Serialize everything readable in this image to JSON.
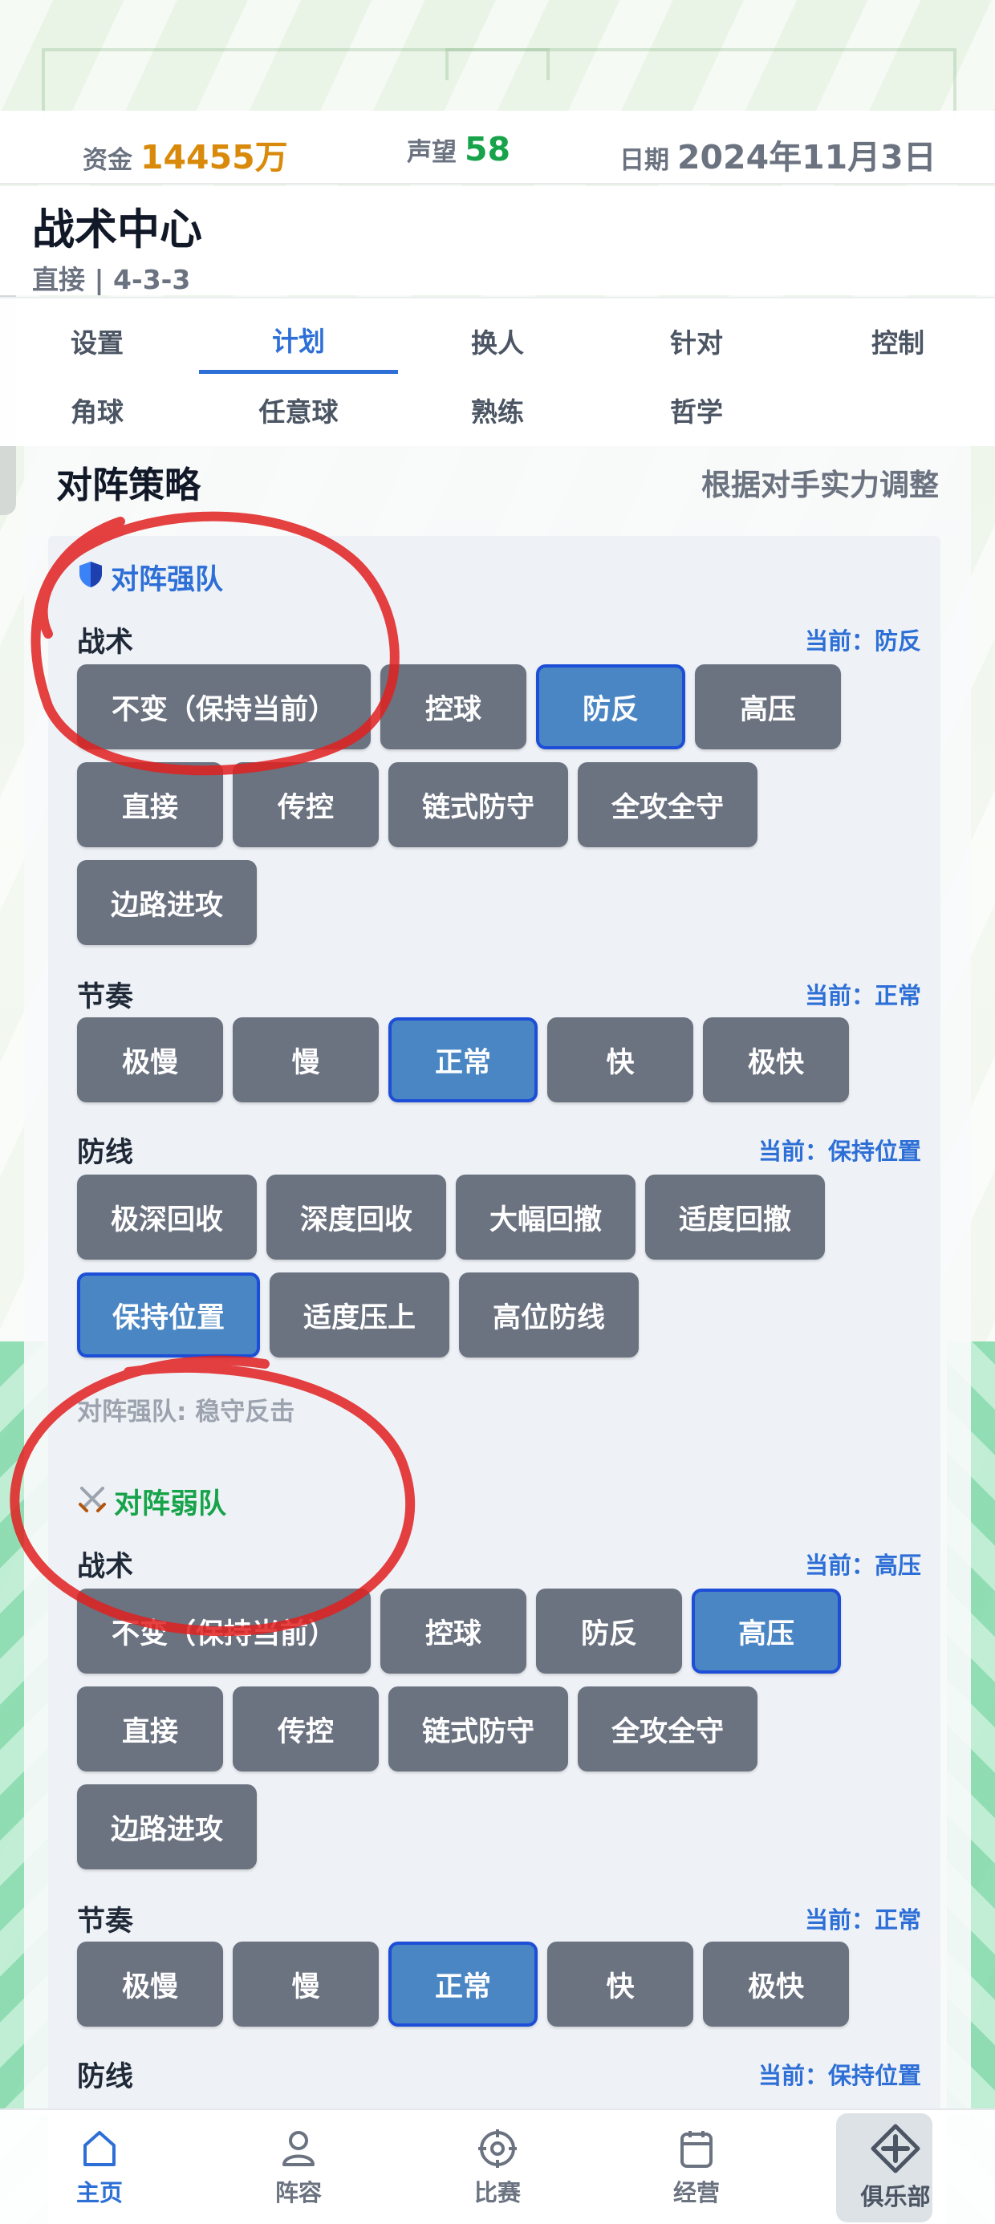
{
  "colors": {
    "accent_blue": "#2d6fd6",
    "button_gray": "#6b7280",
    "button_active": "#4a86c4",
    "funds_orange": "#d98a0b",
    "reputation_green": "#16a34a",
    "annotation_red": "#e02020"
  },
  "stats": {
    "funds_label": "资金",
    "funds_value": "14455万",
    "reputation_label": "声望",
    "reputation_value": "58",
    "date_label": "日期",
    "date_value": "2024年11月3日"
  },
  "header": {
    "title": "战术中心",
    "subtitle": "直接 | 4-3-3"
  },
  "tabs": [
    {
      "label": "设置"
    },
    {
      "label": "计划",
      "active": true
    },
    {
      "label": "换人"
    },
    {
      "label": "针对"
    },
    {
      "label": "控制"
    },
    {
      "label": "角球"
    },
    {
      "label": "任意球"
    },
    {
      "label": "熟练"
    },
    {
      "label": "哲学"
    }
  ],
  "section": {
    "title": "对阵策略",
    "hint": "根据对手实力调整"
  },
  "strong": {
    "icon": "shield-icon",
    "title": "对阵强队",
    "tactic_label": "战术",
    "tactic_current": "当前：防反",
    "tactic_options": [
      "不变（保持当前）",
      "控球",
      "防反",
      "高压",
      "直接",
      "传控",
      "链式防守",
      "全攻全守",
      "边路进攻"
    ],
    "tactic_selected": "防反",
    "tempo_label": "节奏",
    "tempo_current": "当前：正常",
    "tempo_options": [
      "极慢",
      "慢",
      "正常",
      "快",
      "极快"
    ],
    "tempo_selected": "正常",
    "line_label": "防线",
    "line_current": "当前：保持位置",
    "line_options": [
      "极深回收",
      "深度回收",
      "大幅回撤",
      "适度回撤",
      "保持位置",
      "适度压上",
      "高位防线"
    ],
    "line_selected": "保持位置",
    "summary": "对阵强队: 稳守反击"
  },
  "weak": {
    "icon": "crossed-swords-icon",
    "title": "对阵弱队",
    "tactic_label": "战术",
    "tactic_current": "当前：高压",
    "tactic_options": [
      "不变（保持当前）",
      "控球",
      "防反",
      "高压",
      "直接",
      "传控",
      "链式防守",
      "全攻全守",
      "边路进攻"
    ],
    "tactic_selected": "高压",
    "tempo_label": "节奏",
    "tempo_current": "当前：正常",
    "tempo_options": [
      "极慢",
      "慢",
      "正常",
      "快",
      "极快"
    ],
    "tempo_selected": "正常",
    "line_label": "防线",
    "line_current": "当前：保持位置"
  },
  "bottom_nav": [
    {
      "label": "主页",
      "icon": "home-icon",
      "active": true
    },
    {
      "label": "阵容",
      "icon": "person-icon"
    },
    {
      "label": "比赛",
      "icon": "crosshair-icon"
    },
    {
      "label": "经营",
      "icon": "clipboard-icon"
    },
    {
      "label": "俱乐部",
      "icon": "plus-badge-icon"
    }
  ]
}
